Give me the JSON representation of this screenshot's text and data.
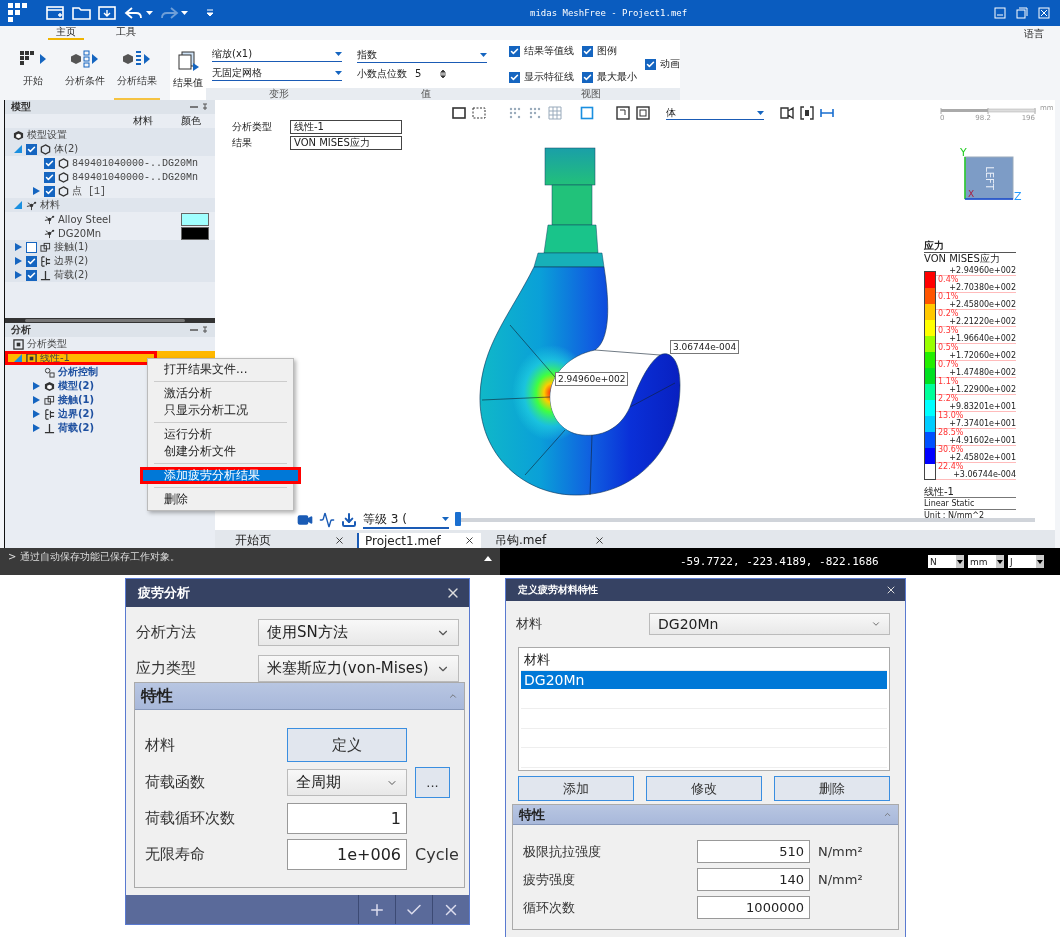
{
  "title_bar": {
    "title": "midas MeshFree - Project1.mef"
  },
  "ribbon": {
    "tabs": [
      {
        "label": "主页",
        "selected": true
      },
      {
        "label": "工具",
        "selected": false
      }
    ],
    "language": "语言",
    "commands": [
      {
        "label": "开始",
        "kind": "start",
        "selected": false
      },
      {
        "label": "分析条件",
        "kind": "conditions",
        "selected": false
      },
      {
        "label": "分析结果",
        "kind": "results",
        "selected": true
      }
    ],
    "result_value": "结果值",
    "deformation": {
      "title": "变形",
      "scale": "缩放(x1)",
      "mesh": "无固定网格"
    },
    "value": {
      "title": "值",
      "format": "指数",
      "decimals_label": "小数点位数",
      "decimals": "5"
    },
    "view": {
      "title": "视图",
      "checks": [
        {
          "label": "结果等值线",
          "checked": true
        },
        {
          "label": "显示特征线",
          "checked": true
        },
        {
          "label": "图例",
          "checked": true
        },
        {
          "label": "最大最小",
          "checked": true
        },
        {
          "label": "动画",
          "checked": true
        }
      ]
    }
  },
  "model_panel": {
    "title": "模型",
    "columns": [
      "材料",
      "颜色"
    ],
    "tree": [
      {
        "kind": "settings",
        "label": "模型设置"
      },
      {
        "kind": "body",
        "label": "体(2)",
        "expanded": true,
        "checked": true,
        "children": [
          {
            "kind": "body",
            "label": "849401040000-..DG20Mn",
            "checked": true
          },
          {
            "kind": "body",
            "label": "849401040000-..DG20Mn",
            "checked": true
          },
          {
            "kind": "body",
            "label": "点 [1]",
            "checked": true,
            "expanded": false
          }
        ]
      },
      {
        "kind": "material",
        "label": "材料",
        "expanded": true,
        "children": [
          {
            "kind": "material",
            "label": "Alloy Steel",
            "color": "#a0ffff"
          },
          {
            "kind": "material",
            "label": "DG20Mn",
            "color": "#000000"
          }
        ]
      },
      {
        "kind": "contact",
        "label": "接触(1)",
        "expanded": false,
        "checked": false
      },
      {
        "kind": "boundary",
        "label": "边界(2)",
        "expanded": false,
        "checked": true
      },
      {
        "kind": "load",
        "label": "荷载(2)",
        "expanded": false,
        "checked": true
      }
    ]
  },
  "analysis_panel": {
    "title": "分析",
    "tree": [
      {
        "kind": "analysis",
        "label": "分析类型",
        "selected": false,
        "highlighted": false
      },
      {
        "kind": "analysis",
        "label": "线性-1",
        "selected": true,
        "highlighted": true,
        "expanded": true,
        "children": [
          {
            "kind": "control",
            "label": "分析控制",
            "selected": false,
            "highlighted": false
          },
          {
            "kind": "model",
            "label": "模型(2)",
            "selected": false,
            "highlighted": false,
            "expanded": false
          },
          {
            "kind": "contact",
            "label": "接触(1)",
            "selected": false,
            "highlighted": false,
            "expanded": false
          },
          {
            "kind": "boundary",
            "label": "边界(2)",
            "selected": false,
            "highlighted": false,
            "expanded": false
          },
          {
            "kind": "load",
            "label": "荷载(2)",
            "selected": false,
            "highlighted": false,
            "expanded": false
          }
        ]
      }
    ]
  },
  "viewport": {
    "info": [
      {
        "label": "分析类型",
        "value": "线性-1"
      },
      {
        "label": "结果",
        "value": "VON MISES应力"
      }
    ],
    "display_select": "体",
    "probes": [
      {
        "value": "3.06744e-004",
        "kind": "min"
      },
      {
        "value": "2.94960e+002",
        "kind": "max"
      }
    ],
    "scale_bar": {
      "labels": [
        "0",
        "98.2",
        "196"
      ],
      "unit": "mm"
    },
    "view_cube": {
      "face": "LEFT",
      "axes": [
        "Y",
        "Z",
        "X"
      ]
    },
    "legend": {
      "title": "应力",
      "subtitle": "VON MISES应力",
      "levels": [
        "+2.94960e+002",
        "+2.70380e+002",
        "+2.45800e+002",
        "+2.21220e+002",
        "+1.96640e+002",
        "+1.72060e+002",
        "+1.47480e+002",
        "+1.22900e+002",
        "+9.83201e+001",
        "+7.37401e+001",
        "+4.91602e+001",
        "+2.45802e+001",
        "+3.06744e-004"
      ],
      "bands": [
        {
          "percent": "0.4%",
          "color": "#ff0000"
        },
        {
          "percent": "0.1%",
          "color": "#ff5500"
        },
        {
          "percent": "0.2%",
          "color": "#ffc800"
        },
        {
          "percent": "0.3%",
          "color": "#ffff00"
        },
        {
          "percent": "0.5%",
          "color": "#99ff00"
        },
        {
          "percent": "0.7%",
          "color": "#22ee00"
        },
        {
          "percent": "1.1%",
          "color": "#00e020"
        },
        {
          "percent": "2.2%",
          "color": "#00ff99"
        },
        {
          "percent": "13.0%",
          "color": "#00ffff"
        },
        {
          "percent": "28.5%",
          "color": "#00ccff"
        },
        {
          "percent": "30.6%",
          "color": "#0050ff"
        },
        {
          "percent": "22.4%",
          "color": "#0000ff"
        }
      ],
      "footer": [
        "线性-1",
        "Linear Static",
        "Unit : N/mm^2"
      ]
    }
  },
  "animation_bar": {
    "level_select": "等级 3 (",
    "slider": {
      "level": 0.0
    }
  },
  "document_tabs": [
    {
      "label": "开始页",
      "selected": false
    },
    {
      "label": "Project1.mef",
      "selected": true
    },
    {
      "label": "吊钩.mef",
      "selected": false
    }
  ],
  "context_menu": {
    "groups": [
      [
        {
          "label": "打开结果文件...",
          "selected": false,
          "highlighted": false
        }
      ],
      [
        {
          "label": "激活分析",
          "selected": false,
          "highlighted": false
        },
        {
          "label": "只显示分析工况",
          "selected": false,
          "highlighted": false
        }
      ],
      [
        {
          "label": "运行分析",
          "selected": false,
          "highlighted": false
        },
        {
          "label": "创建分析文件",
          "selected": false,
          "highlighted": false
        }
      ],
      [
        {
          "label": "添加疲劳分析结果",
          "selected": true,
          "highlighted": true
        }
      ],
      [
        {
          "label": "删除",
          "selected": false,
          "highlighted": false
        }
      ]
    ]
  },
  "status_bar": {
    "message": "> 通过自动保存功能已保存工作对象。",
    "coordinates": "-59.7722, -223.4189, -822.1686",
    "units": [
      "N",
      "mm",
      "J"
    ]
  },
  "fatigue_dialog": {
    "title": "疲劳分析",
    "fields": [
      {
        "label": "分析方法",
        "value": "使用SN方法"
      },
      {
        "label": "应力类型",
        "value": "米塞斯应力(von-Mises)"
      }
    ],
    "section": {
      "title": "特性",
      "expanded": true,
      "rows": [
        {
          "kind": "button",
          "label": "材料",
          "value": "定义"
        },
        {
          "kind": "select",
          "label": "荷载函数",
          "value": "全周期",
          "extra": "..."
        },
        {
          "kind": "input",
          "label": "荷载循环次数",
          "value": "1"
        },
        {
          "kind": "input",
          "label": "无限寿命",
          "value": "1e+006",
          "unit": "Cycle"
        }
      ]
    }
  },
  "material_dialog": {
    "title": "定义疲劳材料特性",
    "material_label": "材料",
    "material": "DG20Mn",
    "list": {
      "header": "材料",
      "rows": [
        {
          "label": "DG20Mn",
          "selected": true
        }
      ]
    },
    "buttons": [
      "添加",
      "修改",
      "删除"
    ],
    "section": {
      "title": "特性",
      "expanded": true,
      "rows": [
        {
          "label": "极限抗拉强度",
          "value": "510",
          "unit": "N/mm²"
        },
        {
          "label": "疲劳强度",
          "value": "140",
          "unit": "N/mm²"
        },
        {
          "label": "循环次数",
          "value": "1000000"
        }
      ]
    }
  }
}
